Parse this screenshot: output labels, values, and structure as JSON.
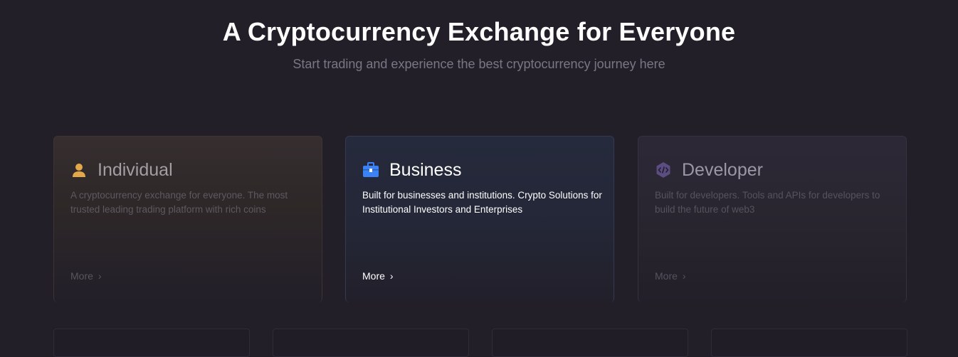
{
  "hero": {
    "title": "A Cryptocurrency Exchange for Everyone",
    "subtitle": "Start trading and experience the best cryptocurrency journey here"
  },
  "cards": [
    {
      "icon": "user-icon",
      "title": "Individual",
      "description": "A cryptocurrency exchange for everyone. The most trusted leading trading platform with rich coins",
      "more": "More",
      "accent": "#e3a84a",
      "active": false
    },
    {
      "icon": "briefcase-icon",
      "title": "Business",
      "description": "Built for businesses and institutions. Crypto Solutions for Institutional Investors and Enterprises",
      "more": "More",
      "accent": "#3b82f6",
      "active": true
    },
    {
      "icon": "code-hexagon-icon",
      "title": "Developer",
      "description": "Built for developers. Tools and APIs for developers to build the future of web3",
      "more": "More",
      "accent": "#6b5b95",
      "active": false
    }
  ],
  "colors": {
    "background": "#221f29",
    "title": "#ffffff",
    "subtitle": "#7a7684"
  }
}
